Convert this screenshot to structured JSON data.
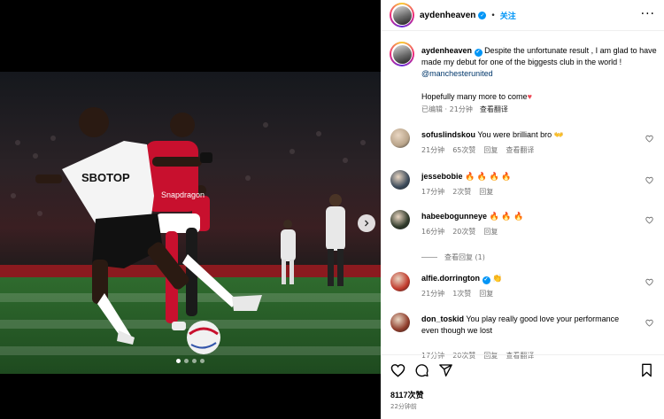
{
  "post": {
    "author": "aydenheaven",
    "follow_separator": "•",
    "follow_label": "关注",
    "caption_text": "Despite the unfortunate result , I am glad to have made my debut for one of the biggests club in the world !",
    "caption_mention": "@manchesterunited",
    "caption_line2": "Hopefully many more to come",
    "caption_emoji": "♥",
    "caption_edited": "已编辑",
    "caption_dot": "·",
    "caption_time": "21分钟",
    "see_translation": "查看翻译",
    "likes": "8117次赞",
    "posted_ago": "22分钟前",
    "carousel": {
      "total": 4,
      "active": 0
    }
  },
  "comments": [
    {
      "user": "sofuslindskou",
      "text": "You were brilliant bro",
      "emoji": "👐",
      "time": "21分钟",
      "likes": "65次赞",
      "reply": "回复",
      "translate": "查看翻译",
      "avatar_color": "#b9a48a"
    },
    {
      "user": "jessebobie",
      "text": "",
      "emoji": "🔥 🔥 🔥 🔥",
      "time": "17分钟",
      "likes": "2次赞",
      "reply": "回复",
      "translate": "",
      "avatar_color": "#3b4a5a"
    },
    {
      "user": "habeebogunneye",
      "text": "",
      "emoji": "🔥 🔥 🔥",
      "time": "16分钟",
      "likes": "20次赞",
      "reply": "回复",
      "translate": "",
      "avatar_color": "#2f3a2a"
    },
    {
      "user": "alfie.dorrington",
      "text": "",
      "emoji": "👏",
      "time": "21分钟",
      "likes": "1次赞",
      "reply": "回复",
      "translate": "",
      "avatar_color": "#c0392b",
      "verified": true
    },
    {
      "user": "don_toskid",
      "text": "You play really good love your performance even though we lost",
      "emoji": "",
      "time": "17分钟",
      "likes": "20次赞",
      "reply": "回复",
      "translate": "查看翻译",
      "avatar_color": "#8e3b2a"
    }
  ],
  "view_replies": "查看回复 (1)",
  "icons": {
    "verified": "verified-badge-icon",
    "more": "more-options-icon",
    "heart": "heart-icon",
    "comment": "comment-icon",
    "share": "share-icon",
    "save": "bookmark-icon",
    "next": "chevron-right-icon"
  },
  "colors": {
    "accent": "#0095f6",
    "mention": "#00376b",
    "secondary_text": "#737373",
    "heart": "#ed4956"
  }
}
